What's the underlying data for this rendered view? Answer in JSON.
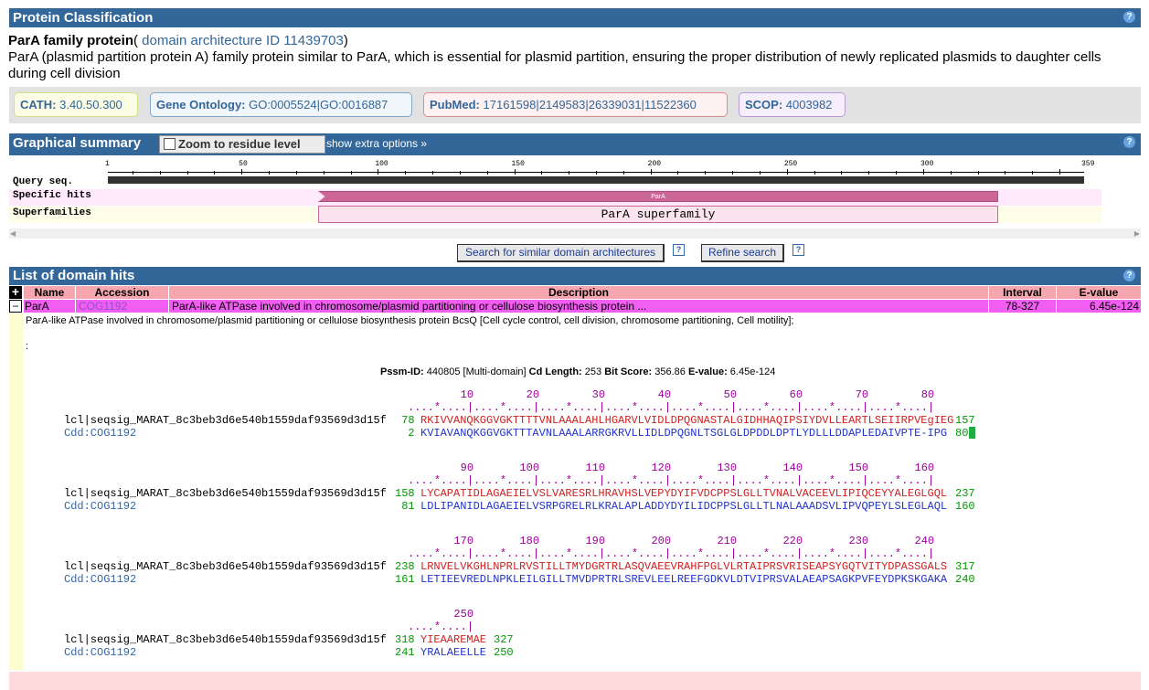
{
  "protein_classification": {
    "header": "Protein Classification",
    "help_label": "?",
    "protein_name": "ParA family protein",
    "open_paren": "(",
    "arch_link": "domain architecture ID 11439703",
    "close_paren": ")",
    "description": "ParA (plasmid partition protein A) family protein similar to ParA, which is essential for plasmid partition, ensuring the proper distribution of newly replicated plasmids to daughter cells during cell division",
    "badges": {
      "cath": {
        "label": "CATH:",
        "value": "3.40.50.300"
      },
      "go": {
        "label": "Gene Ontology:",
        "value": "GO:0005524|GO:0016887"
      },
      "pubmed": {
        "label": "PubMed:",
        "value": "17161598|2149583|26339031|11522360"
      },
      "scop": {
        "label": "SCOP:",
        "value": "4003982"
      }
    }
  },
  "graphical_summary": {
    "header": "Graphical summary",
    "zoom_label": "Zoom to residue level",
    "extra_options": "show extra options »",
    "help_label": "?",
    "ruler_ticks": [
      "1",
      "50",
      "100",
      "150",
      "200",
      "250",
      "300",
      "359"
    ],
    "row_labels": {
      "query": "Query seq.",
      "specific": "Specific hits",
      "super": "Superfamilies"
    },
    "specific_hit_label": "ParA",
    "superfamily_label": "ParA superfamily",
    "scroll_left": "◀",
    "scroll_right": "▶"
  },
  "actions": {
    "search_similar": "Search for similar domain architectures",
    "refine": "Refine search",
    "help_label": "?"
  },
  "domain_hits": {
    "header": "List of domain hits",
    "help_label": "?",
    "columns": {
      "name": "Name",
      "accession": "Accession",
      "description": "Description",
      "interval": "Interval",
      "evalue": "E-value"
    },
    "expand_all": "+",
    "collapse": "−",
    "row": {
      "name": "ParA",
      "accession": "COG1192",
      "description": "ParA-like ATPase involved in chromosome/plasmid partitioning or cellulose biosynthesis protein ...",
      "interval": "78-327",
      "evalue": "6.45e-124"
    },
    "full_description": "ParA-like ATPase involved in chromosome/plasmid partitioning or cellulose biosynthesis protein BcsQ [Cell cycle control, cell division, chromosome partitioning, Cell motility];",
    "colon": ":",
    "stats": {
      "pssm_label": "Pssm-ID:",
      "pssm_value": "440805 [Multi-domain]",
      "cd_label": "Cd Length:",
      "cd_value": "253",
      "bit_label": "Bit Score:",
      "bit_value": "356.86",
      "ev_label": "E-value:",
      "ev_value": "6.45e-124"
    },
    "alignment_blocks": [
      {
        "numbers": "                  10        20        30        40        50        60        70        80",
        "ruler": "          ....*....|....*....|....*....|....*....|....*....|....*....|....*....|....*....|",
        "query_name": "lcl|seqsig_MARAT_8c3beb3d6e540b1559daf93569d3d15f",
        "query_start": " 78",
        "query_seq": "RKIVVANQKGGVGKTTTTVNLAAALAHLHGARVLVIDLDPQGNASTALGIDHHAQIPSIYDVLLEARTLSEIIRPVEgIEG",
        "query_end": "157",
        "subject_name": "Cdd:COG1192",
        "subject_start": "  2",
        "subject_seq": "KVIAVANQKGGVGKTTTAVNLAAALARRGKRVLLIDLDPQGNLTSGLGLDPDDLDPTLYDLLLDDAPLEDAIVPTE-IPG",
        "subject_end": "80"
      },
      {
        "numbers": "                  90       100       110       120       130       140       150       160",
        "ruler": "          ....*....|....*....|....*....|....*....|....*....|....*....|....*....|....*....|",
        "query_name": "lcl|seqsig_MARAT_8c3beb3d6e540b1559daf93569d3d15f",
        "query_start": "158",
        "query_seq": "LYCAPATIDLAGAEIELVSLVARESRLHRAVHSLVEPYDYIFVDCPPSLGLLTVNALVACEEVLIPIQCEYYALEGLGQL",
        "query_end": "237",
        "subject_name": "Cdd:COG1192",
        "subject_start": " 81",
        "subject_seq": "LDLIPANIDLAGAEIELVSRPGRELRLKRALAPLADDYDYILIDCPPSLGLLTLNALAAADSVLIPVQPEYLSLEGLAQL",
        "subject_end": "160"
      },
      {
        "numbers": "                 170       180       190       200       210       220       230       240",
        "ruler": "          ....*....|....*....|....*....|....*....|....*....|....*....|....*....|....*....|",
        "query_name": "lcl|seqsig_MARAT_8c3beb3d6e540b1559daf93569d3d15f",
        "query_start": "238",
        "query_seq": "LRNVELVKGHLNPRLRVSTILLTMYDGRTRLASQVAEEVRAHFPGLVLRTAIPRSVRISEAPSYGQTVITYDPASSGALS",
        "query_end": "317",
        "subject_name": "Cdd:COG1192",
        "subject_start": "161",
        "subject_seq": "LETIEEVREDLNPKLEILGILLTMVDPRTRLSREVLEELREEFGDKVLDTVIPRSVALAEAPSAGKPVFEYDPKSKGAKA",
        "subject_end": "240"
      },
      {
        "numbers": "                 250",
        "ruler": "          ....*....|",
        "query_name": "lcl|seqsig_MARAT_8c3beb3d6e540b1559daf93569d3d15f",
        "query_start": "318",
        "query_seq": "YIEAAREMAE",
        "query_end": "327",
        "subject_name": "Cdd:COG1192",
        "subject_start": "241",
        "subject_seq": "YRALAEELLE",
        "subject_end": "250"
      }
    ]
  },
  "colors": {
    "header_blue": "#336699",
    "hit_pink": "#cc6699",
    "row_magenta": "#f25ef2",
    "link_blue": "#336699"
  }
}
